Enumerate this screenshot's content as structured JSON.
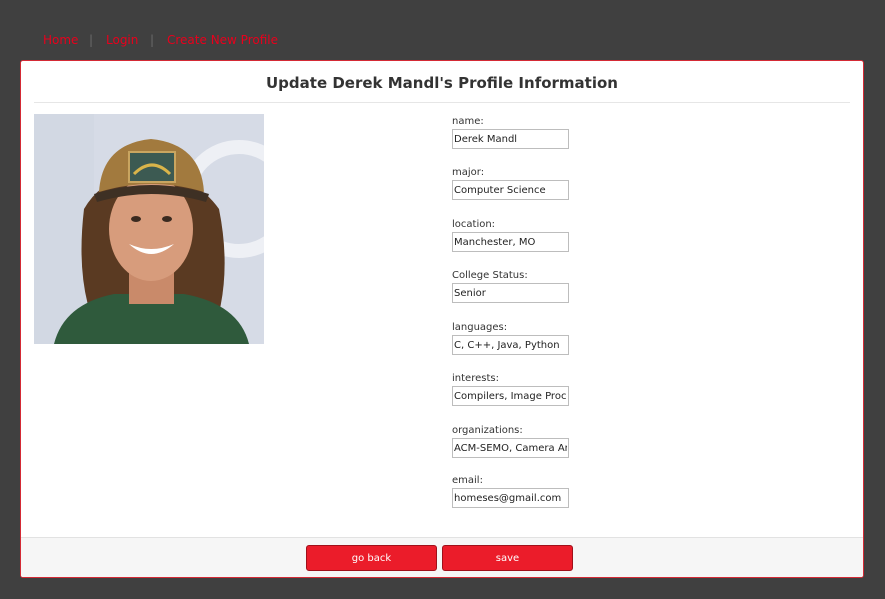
{
  "nav": {
    "home": "Home",
    "login": "Login",
    "create_profile": "Create New Profile",
    "separator": "|"
  },
  "card": {
    "title": "Update Derek Mandl's Profile Information"
  },
  "profile_photo": {
    "icon": "profile-photo"
  },
  "fields": [
    {
      "label": "name:",
      "value": "Derek Mandl"
    },
    {
      "label": "major:",
      "value": "Computer Science"
    },
    {
      "label": "location:",
      "value": "Manchester, MO"
    },
    {
      "label": "College Status:",
      "value": "Senior"
    },
    {
      "label": "languages:",
      "value": "C, C++, Java, Python"
    },
    {
      "label": "interests:",
      "value": "Compilers, Image Processing"
    },
    {
      "label": "organizations:",
      "value": "ACM-SEMO, Camera Arts"
    },
    {
      "label": "email:",
      "value": "homeses@gmail.com"
    }
  ],
  "footer": {
    "back_label": "go back",
    "save_label": "save"
  },
  "colors": {
    "accent": "#eb1c2a",
    "page_background": "#404040",
    "link": "#e8001c"
  }
}
